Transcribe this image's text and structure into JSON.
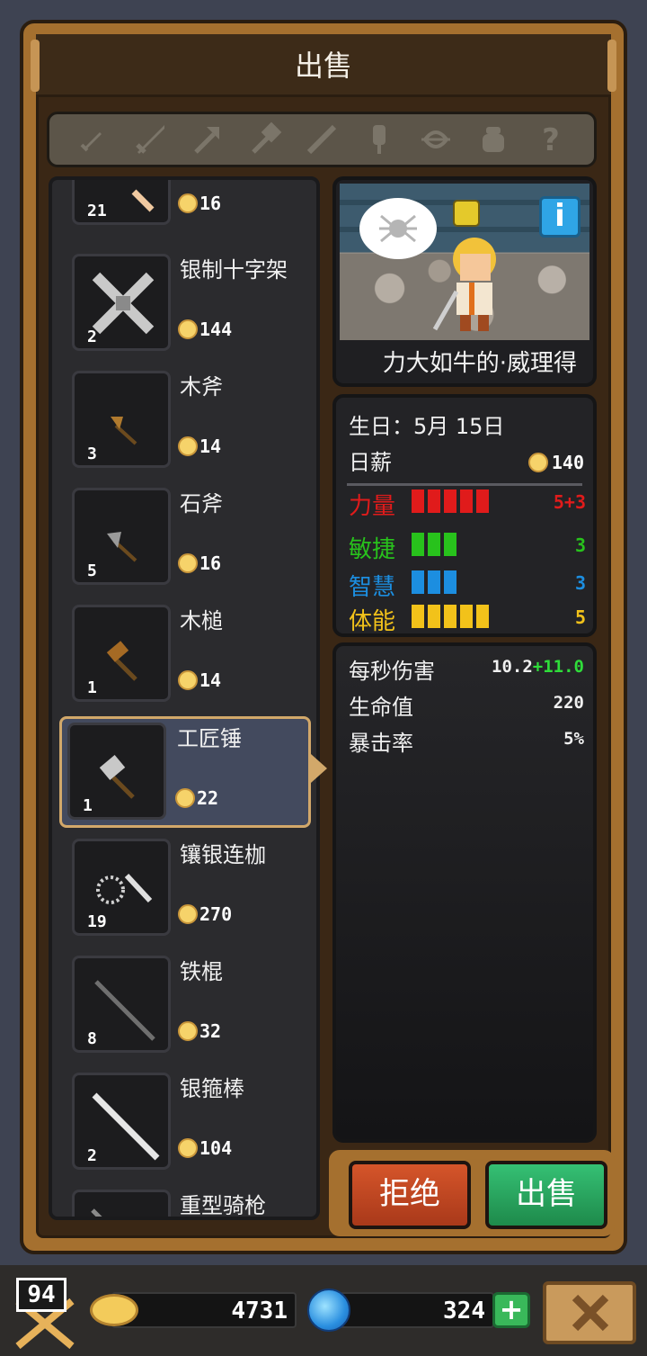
{
  "title": "出售",
  "categories": [
    "dagger-icon",
    "sword-icon",
    "axe-icon",
    "hammer-icon",
    "staff-icon",
    "mace-icon",
    "bow-icon",
    "pot-icon",
    "question-icon"
  ],
  "items": [
    {
      "name": "",
      "qty": "21",
      "price": "16",
      "icon": "partial-item-icon"
    },
    {
      "name": "银制十字架",
      "qty": "2",
      "price": "144",
      "icon": "silver-cross-icon"
    },
    {
      "name": "木斧",
      "qty": "3",
      "price": "14",
      "icon": "wood-axe-icon"
    },
    {
      "name": "石斧",
      "qty": "5",
      "price": "16",
      "icon": "stone-axe-icon"
    },
    {
      "name": "木槌",
      "qty": "1",
      "price": "14",
      "icon": "wood-mallet-icon"
    },
    {
      "name": "工匠锤",
      "qty": "1",
      "price": "22",
      "icon": "craftsman-hammer-icon",
      "selected": true
    },
    {
      "name": "镶银连枷",
      "qty": "19",
      "price": "270",
      "icon": "silver-flail-icon"
    },
    {
      "name": "铁棍",
      "qty": "8",
      "price": "32",
      "icon": "iron-rod-icon"
    },
    {
      "name": "银箍棒",
      "qty": "2",
      "price": "104",
      "icon": "silver-staff-icon"
    },
    {
      "name": "重型骑枪",
      "qty": "",
      "price": "",
      "icon": "heavy-lance-icon"
    }
  ],
  "hero": {
    "name": "力大如牛的·威理得",
    "birthday": "生日：5月 15日",
    "salary_label": "日薪",
    "salary": "140",
    "attributes": [
      {
        "label": "力量",
        "value": "5+3",
        "bars": 5,
        "color": "#e01b1b"
      },
      {
        "label": "敏捷",
        "value": "3",
        "bars": 3,
        "color": "#28c21c"
      },
      {
        "label": "智慧",
        "value": "3",
        "bars": 3,
        "color": "#1c8ee0"
      },
      {
        "label": "体能",
        "value": "5",
        "bars": 5,
        "color": "#f2c21a"
      }
    ],
    "combat": {
      "dps_label": "每秒伤害",
      "dps_base": "10.2",
      "dps_bonus": "+11.0",
      "hp_label": "生命值",
      "hp": "220",
      "crit_label": "暴击率",
      "crit": "5%"
    }
  },
  "buttons": {
    "reject": "拒绝",
    "sell": "出售"
  },
  "footer": {
    "level": "94",
    "gold": "4731",
    "gems": "324"
  }
}
